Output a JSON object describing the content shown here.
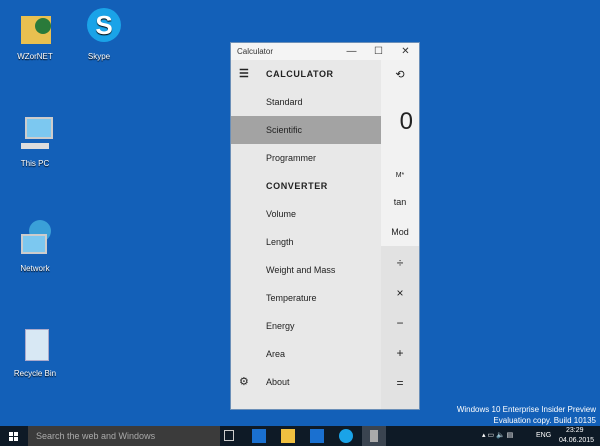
{
  "desktop": {
    "icons": [
      {
        "label": "WZorNET"
      },
      {
        "label": "Skype"
      },
      {
        "label": "This PC"
      },
      {
        "label": "Network"
      },
      {
        "label": "Recycle Bin"
      }
    ]
  },
  "window": {
    "title": "Calculator",
    "minimize": "—",
    "maximize": "☐",
    "close": "✕"
  },
  "nav": {
    "calculator_header": "CALCULATOR",
    "items_calc": [
      "Standard",
      "Scientific",
      "Programmer"
    ],
    "converter_header": "CONVERTER",
    "items_conv": [
      "Volume",
      "Length",
      "Weight and Mass",
      "Temperature",
      "Energy",
      "Area"
    ],
    "about": "About",
    "selected": "Scientific"
  },
  "calc": {
    "display": "0",
    "keys": [
      "M*",
      "tan",
      "Mod",
      "÷",
      "×",
      "−",
      "+",
      "="
    ]
  },
  "taskbar": {
    "search_placeholder": "Search the web and Windows",
    "lang": "ENG",
    "time": "23:29",
    "date": "04.06.2015"
  },
  "watermark": {
    "line1": "Windows 10 Enterprise Insider Preview",
    "line2": "Evaluation copy. Build 10135"
  }
}
